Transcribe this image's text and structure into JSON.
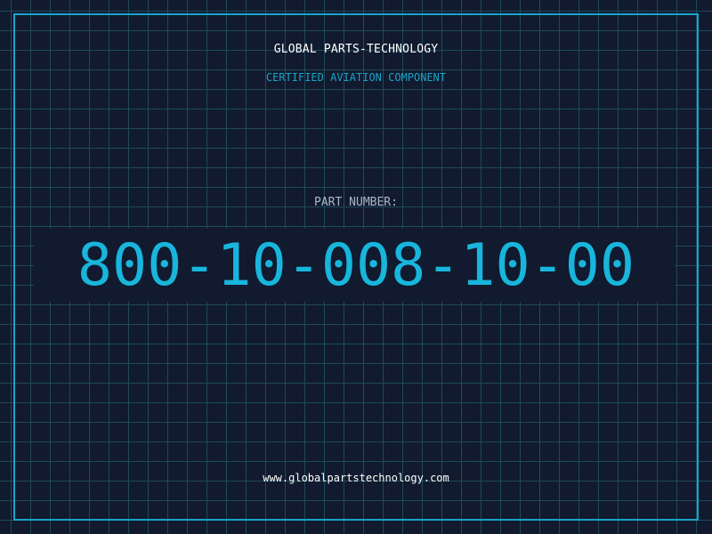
{
  "header": {
    "title": "GLOBAL PARTS-TECHNOLOGY",
    "subtitle": "CERTIFIED AVIATION COMPONENT"
  },
  "part": {
    "label": "PART NUMBER:",
    "number": "800-10-008-10-00"
  },
  "footer": {
    "url": "www.globalpartstechnology.com"
  },
  "colors": {
    "background": "#111a2e",
    "grid": "#1e4a5c",
    "accent": "#1aa3c7",
    "part_number": "#18b5dc"
  }
}
